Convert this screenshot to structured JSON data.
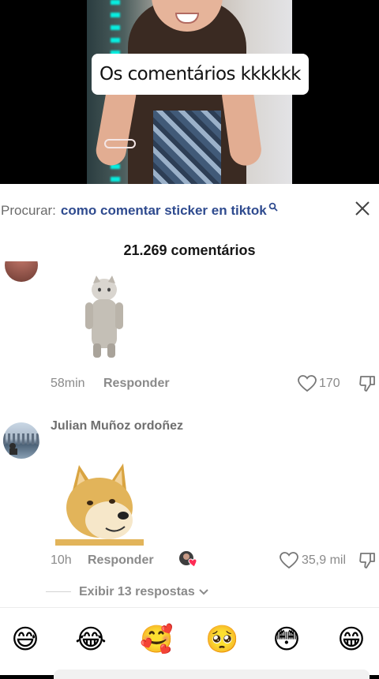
{
  "video": {
    "caption": "Os comentários kkkkkk"
  },
  "search": {
    "label": "Procurar:",
    "term": "como comentar sticker en tiktok",
    "icon": "search-icon"
  },
  "comments_header": {
    "count_text": "21.269 comentários"
  },
  "comment1": {
    "time": "58min",
    "reply_label": "Responder",
    "likes": "170"
  },
  "comment2": {
    "username": "Julian Muñoz ordoñez",
    "time": "10h",
    "reply_label": "Responder",
    "likes": "35,9 mil",
    "view_replies": "Exibir 13 respostas"
  },
  "emoji_bar": {
    "emojis": [
      "😅",
      "😂",
      "🥰",
      "🥺",
      "😳",
      "😁"
    ]
  },
  "colors": {
    "link_blue": "#2f4b8f",
    "muted_gray": "#8a8a8a"
  }
}
